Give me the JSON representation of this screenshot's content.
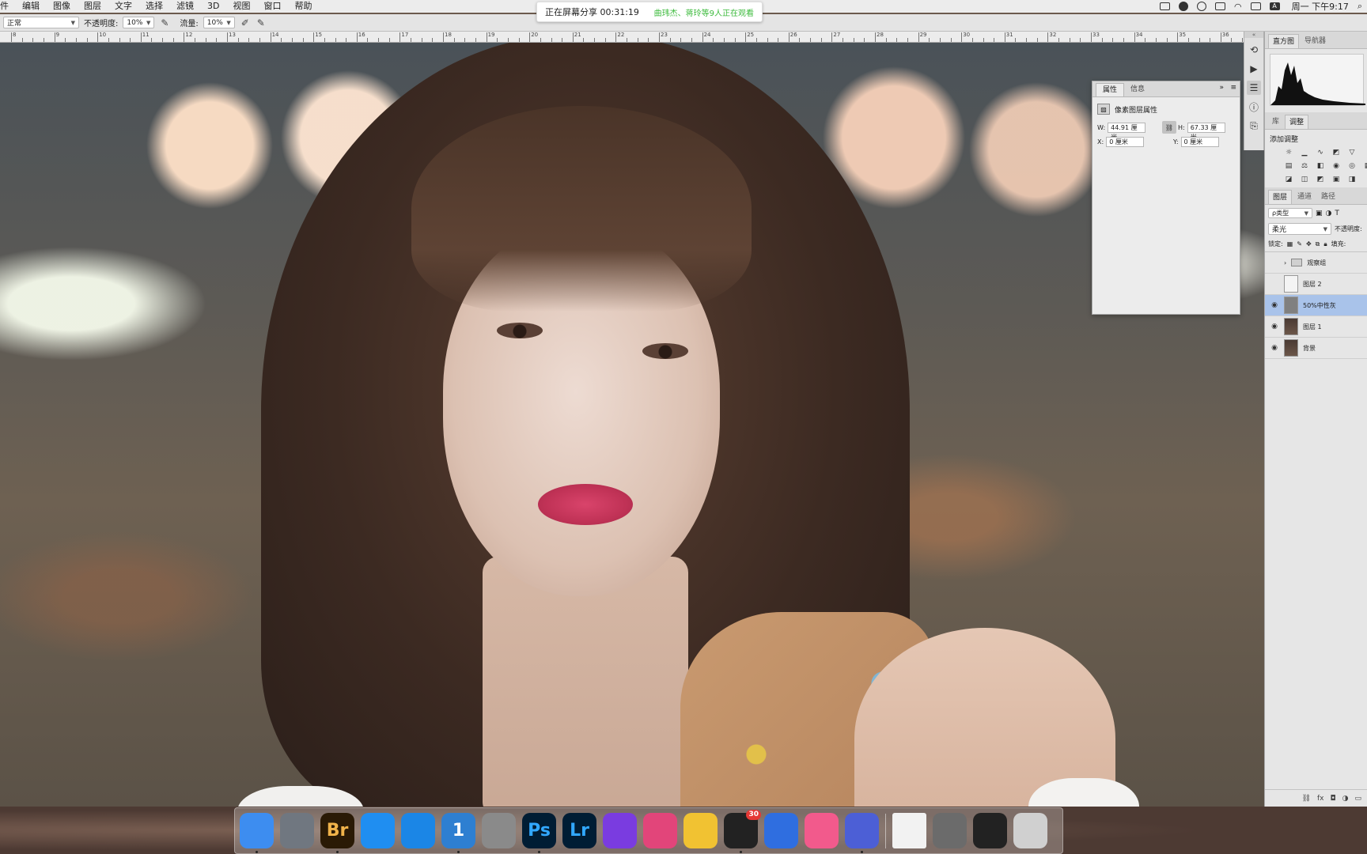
{
  "menubar": {
    "items": [
      "件",
      "编辑",
      "图像",
      "图层",
      "文字",
      "选择",
      "滤镜",
      "3D",
      "视图",
      "窗口",
      "帮助"
    ],
    "clock": "周一 下午9:17",
    "tray_icons": [
      "screen-record-icon",
      "qq-icon",
      "creative-cloud-icon",
      "airplay-icon",
      "wifi-icon",
      "display-icon",
      "input-method-icon",
      "spotlight-icon"
    ],
    "input_method": "A"
  },
  "share_banner": {
    "status": "正在屏幕分享 00:31:19",
    "viewers": "曲玮杰、蒋玲等9人正在观看"
  },
  "options": {
    "mode": "正常",
    "opacity_label": "不透明度:",
    "opacity_value": "10%",
    "flow_label": "流量:",
    "flow_value": "10%"
  },
  "ruler": {
    "labels": [
      "8",
      "9",
      "10",
      "11",
      "12",
      "13",
      "14",
      "15",
      "16",
      "17",
      "18",
      "19",
      "20",
      "21",
      "22",
      "23",
      "24",
      "25",
      "26",
      "27",
      "28",
      "29",
      "30",
      "31",
      "32",
      "33",
      "34",
      "35",
      "36"
    ]
  },
  "properties": {
    "tabs": [
      "属性",
      "信息"
    ],
    "title": "像素图层属性",
    "w_label": "W:",
    "w_value": "44.91 厘米",
    "h_label": "H:",
    "h_value": "67.33 厘米",
    "x_label": "X:",
    "x_value": "0 厘米",
    "y_label": "Y:",
    "y_value": "0 厘米"
  },
  "right_panel": {
    "top_tabs": [
      "直方图",
      "导航器"
    ],
    "mid_tabs": [
      "库",
      "调整"
    ],
    "add_adjustment": "添加调整",
    "layer_tabs": [
      "图层",
      "通道",
      "路径"
    ],
    "filter_kind": "ρ类型",
    "blend_mode": "柔光",
    "opacity_label": "不透明度:",
    "lock_label": "锁定:",
    "fill_label": "填充:",
    "layers": [
      {
        "name": "观察组",
        "visible": false,
        "kind": "group",
        "selected": false
      },
      {
        "name": "图层 2",
        "visible": false,
        "kind": "layer",
        "selected": false
      },
      {
        "name": "50%中性灰",
        "visible": true,
        "kind": "layer",
        "selected": true
      },
      {
        "name": "图层 1",
        "visible": true,
        "kind": "layer",
        "selected": false
      },
      {
        "name": "背景",
        "visible": true,
        "kind": "layer",
        "selected": false
      }
    ]
  },
  "dock": {
    "apps": [
      {
        "name": "finder-icon",
        "label": "",
        "color": "#3d8df0",
        "running": true
      },
      {
        "name": "launchpad-icon",
        "label": "",
        "color": "#707780",
        "running": false
      },
      {
        "name": "bridge-icon",
        "label": "Br",
        "color": "#2a1a05",
        "running": true
      },
      {
        "name": "app-store-icon",
        "label": "",
        "color": "#1f8ef1",
        "running": false
      },
      {
        "name": "safari-icon",
        "label": "",
        "color": "#1b86e6",
        "running": false
      },
      {
        "name": "1password-icon",
        "label": "1",
        "color": "#2e7fd1",
        "running": true
      },
      {
        "name": "system-preferences-icon",
        "label": "",
        "color": "#8a8a8a",
        "running": false
      },
      {
        "name": "photoshop-icon",
        "label": "Ps",
        "color": "#001d34",
        "running": true
      },
      {
        "name": "lightroom-icon",
        "label": "Lr",
        "color": "#001d34",
        "running": false
      },
      {
        "name": "imovie-icon",
        "label": "",
        "color": "#7a3ce0",
        "running": false
      },
      {
        "name": "screens-icon",
        "label": "",
        "color": "#e2457a",
        "running": false
      },
      {
        "name": "qq-music-icon",
        "label": "",
        "color": "#f1c232",
        "running": false
      },
      {
        "name": "qq-icon",
        "label": "",
        "color": "#222222",
        "running": true
      },
      {
        "name": "baidu-netdisk-icon",
        "label": "",
        "color": "#2f6ee0",
        "running": false
      },
      {
        "name": "itunes-icon",
        "label": "",
        "color": "#f25a8c",
        "running": false
      },
      {
        "name": "video-app-icon",
        "label": "",
        "color": "#4c5fd6",
        "running": true
      }
    ],
    "qq_badge": "30",
    "stack_items": [
      {
        "name": "document-stack-icon",
        "label": "",
        "color": "#f2f2f2"
      },
      {
        "name": "downloads-stack-icon",
        "label": "",
        "color": "#6b6b6b"
      },
      {
        "name": "screenshot-stack-icon",
        "label": "",
        "color": "#222222"
      },
      {
        "name": "trash-icon",
        "label": "",
        "color": "#d0d0d0"
      }
    ]
  }
}
